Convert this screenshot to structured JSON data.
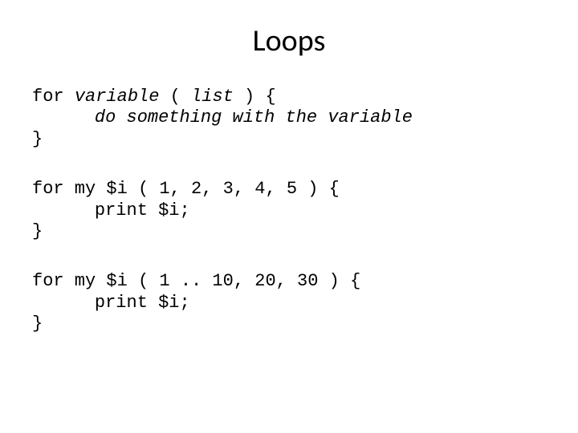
{
  "slide": {
    "title": "Loops",
    "block1": {
      "line1_prefix": "for ",
      "line1_var": "variable",
      "line1_mid": " ( ",
      "line1_list": "list",
      "line1_suffix": " ) {",
      "line2": "do something with the variable",
      "line3": "}"
    },
    "block2": {
      "line1": "for my $i ( 1, 2, 3, 4, 5 ) {",
      "line2": "print $i;",
      "line3": "}"
    },
    "block3": {
      "line1": "for my $i ( 1 .. 10, 20, 30 ) {",
      "line2": "print $i;",
      "line3": "}"
    }
  }
}
